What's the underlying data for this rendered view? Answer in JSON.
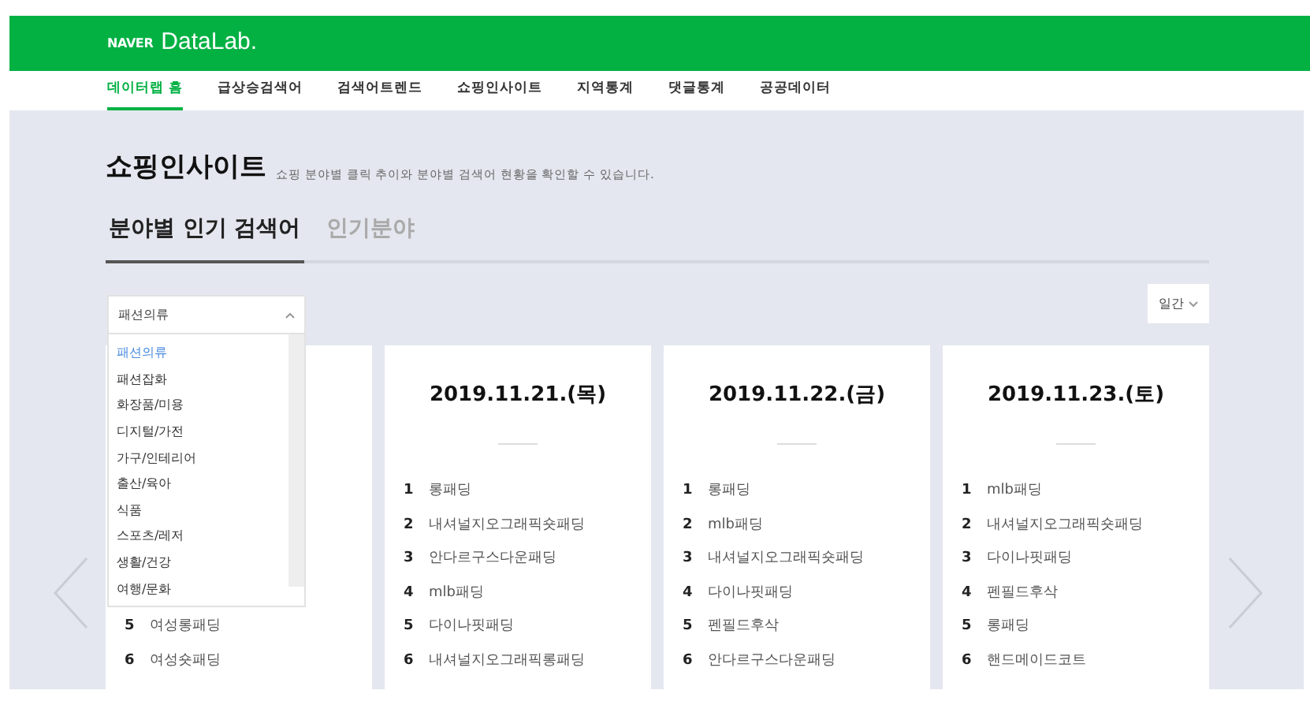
{
  "header": {
    "brand": "NAVER",
    "product": "DataLab."
  },
  "nav": [
    {
      "label": "데이터랩 홈",
      "selected": true
    },
    {
      "label": "급상승검색어",
      "selected": false
    },
    {
      "label": "검색어트렌드",
      "selected": false
    },
    {
      "label": "쇼핑인사이트",
      "selected": false
    },
    {
      "label": "지역통계",
      "selected": false
    },
    {
      "label": "댓글통계",
      "selected": false
    },
    {
      "label": "공공데이터",
      "selected": false
    }
  ],
  "page": {
    "title": "쇼핑인사이트",
    "subtitle": "쇼핑 분야별 클릭 추이와 분야별 검색어 현황을 확인할 수 있습니다."
  },
  "tabs": [
    {
      "label": "분야별 인기 검색어",
      "selected": true
    },
    {
      "label": "인기분야",
      "selected": false
    }
  ],
  "category_select": {
    "value": "패션의류",
    "expanded": true,
    "options": [
      {
        "label": "패션의류",
        "selected": true
      },
      {
        "label": "패션잡화",
        "selected": false
      },
      {
        "label": "화장품/미용",
        "selected": false
      },
      {
        "label": "디지털/가전",
        "selected": false
      },
      {
        "label": "가구/인테리어",
        "selected": false
      },
      {
        "label": "출산/육아",
        "selected": false
      },
      {
        "label": "식품",
        "selected": false
      },
      {
        "label": "스포츠/레저",
        "selected": false
      },
      {
        "label": "생활/건강",
        "selected": false
      },
      {
        "label": "여행/문화",
        "selected": false
      }
    ]
  },
  "period_select": {
    "value": "일간"
  },
  "cards": [
    {
      "items": [
        {
          "rank": "5",
          "keyword": "여성롱패딩"
        },
        {
          "rank": "6",
          "keyword": "여성숏패딩"
        }
      ]
    },
    {
      "date": "2019.11.21.(목)",
      "items": [
        {
          "rank": "1",
          "keyword": "롱패딩"
        },
        {
          "rank": "2",
          "keyword": "내셔널지오그래픽숏패딩"
        },
        {
          "rank": "3",
          "keyword": "안다르구스다운패딩"
        },
        {
          "rank": "4",
          "keyword": "mlb패딩"
        },
        {
          "rank": "5",
          "keyword": "다이나핏패딩"
        },
        {
          "rank": "6",
          "keyword": "내셔널지오그래픽롱패딩"
        }
      ]
    },
    {
      "date": "2019.11.22.(금)",
      "items": [
        {
          "rank": "1",
          "keyword": "롱패딩"
        },
        {
          "rank": "2",
          "keyword": "mlb패딩"
        },
        {
          "rank": "3",
          "keyword": "내셔널지오그래픽숏패딩"
        },
        {
          "rank": "4",
          "keyword": "다이나핏패딩"
        },
        {
          "rank": "5",
          "keyword": "펜필드후삭"
        },
        {
          "rank": "6",
          "keyword": "안다르구스다운패딩"
        }
      ]
    },
    {
      "date": "2019.11.23.(토)",
      "items": [
        {
          "rank": "1",
          "keyword": "mlb패딩"
        },
        {
          "rank": "2",
          "keyword": "내셔널지오그래픽숏패딩"
        },
        {
          "rank": "3",
          "keyword": "다이나핏패딩"
        },
        {
          "rank": "4",
          "keyword": "펜필드후삭"
        },
        {
          "rank": "5",
          "keyword": "롱패딩"
        },
        {
          "rank": "6",
          "keyword": "핸드메이드코트"
        }
      ]
    }
  ]
}
